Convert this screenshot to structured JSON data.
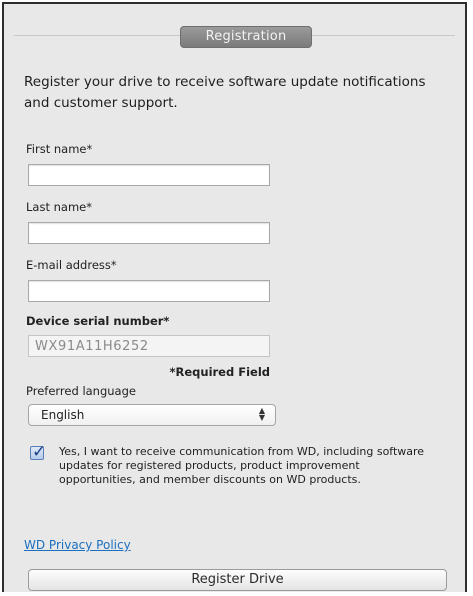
{
  "section_tab": "Registration",
  "intro": "Register your drive to receive software update notifications and customer support.",
  "fields": {
    "first_name": {
      "label": "First name*",
      "value": ""
    },
    "last_name": {
      "label": "Last name*",
      "value": ""
    },
    "email": {
      "label": "E-mail address*",
      "value": ""
    },
    "serial": {
      "label": "Device serial number*",
      "value": "WX91A11H6252"
    }
  },
  "required_note": "*Required Field",
  "language": {
    "label": "Preferred language",
    "selected": "English"
  },
  "consent": {
    "checked": true,
    "text": "Yes, I want to receive communication from WD, including software updates for registered products, product improvement opportunities, and member discounts on WD products."
  },
  "privacy_link": "WD Privacy Policy",
  "register_button": "Register Drive"
}
